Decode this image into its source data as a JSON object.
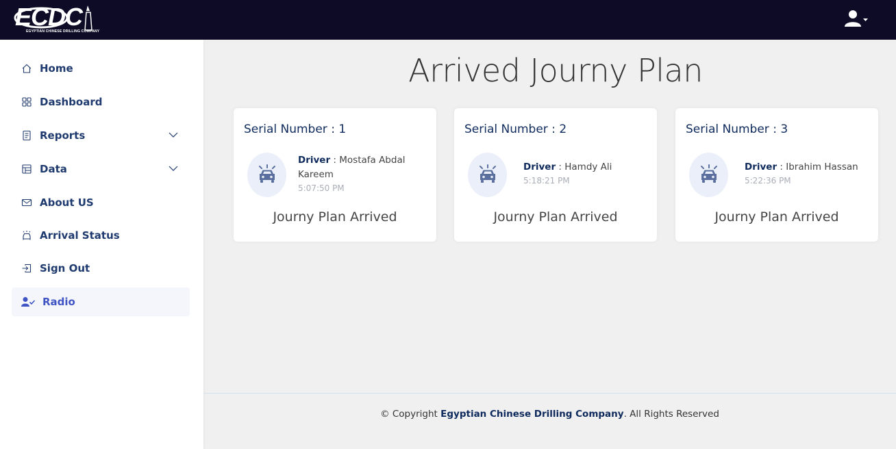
{
  "header": {
    "logo_text": "ECDC",
    "logo_subtitle": "EGYPTIAN CHINESE DRILLING COMPANY",
    "user_icon": "user-icon"
  },
  "sidebar": {
    "items": [
      {
        "label": "Home",
        "icon": "home-icon"
      },
      {
        "label": "Dashboard",
        "icon": "grid-icon"
      },
      {
        "label": "Reports",
        "icon": "journal-icon"
      },
      {
        "label": "Data",
        "icon": "table-icon"
      },
      {
        "label": "About US",
        "icon": "envelope-icon"
      },
      {
        "label": "Arrival Status",
        "icon": "car-icon"
      },
      {
        "label": "Sign Out",
        "icon": "sign-out-icon"
      },
      {
        "label": "Radio",
        "icon": "user-check-icon"
      }
    ],
    "active_item": "Radio"
  },
  "main": {
    "title": "Arrived Journy Plan",
    "cards": [
      {
        "serial_label": "Serial Number : 1",
        "driver_key": "Driver",
        "driver_name": "Mostafa Abdal Kareem",
        "time": "5:07:50 PM",
        "status": "Journy Plan Arrived"
      },
      {
        "serial_label": "Serial Number : 2",
        "driver_key": "Driver",
        "driver_name": "Hamdy Ali",
        "time": "5:18:21 PM",
        "status": "Journy Plan Arrived"
      },
      {
        "serial_label": "Serial Number : 3",
        "driver_key": "Driver",
        "driver_name": "Ibrahim Hassan",
        "time": "5:22:36 PM",
        "status": "Journy Plan Arrived"
      }
    ]
  },
  "footer": {
    "prefix": "© Copyright",
    "company": "Egyptian Chinese Drilling Company",
    "suffix": ". All Rights Reserved"
  },
  "colors": {
    "header_bg": "#0d0b26",
    "nav_text": "#1f3a6e",
    "active_text": "#4154c4",
    "card_title": "#0e2a5c"
  }
}
